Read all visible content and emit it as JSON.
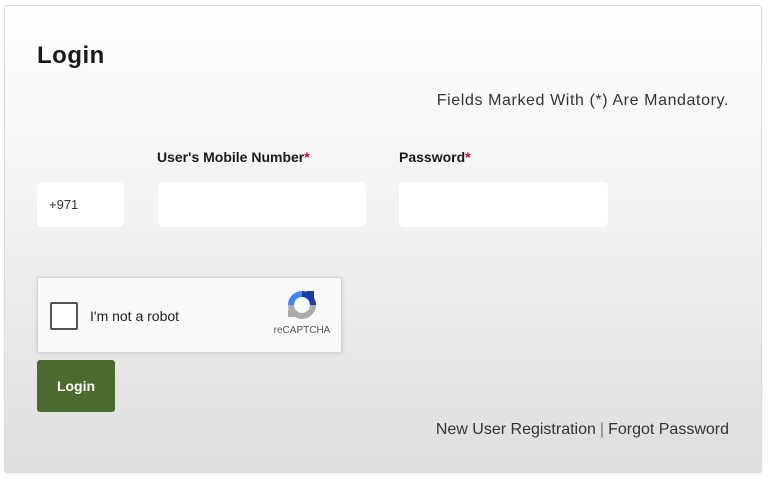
{
  "form": {
    "title": "Login",
    "mandatory_note": "Fields Marked With (*) Are Mandatory.",
    "mobile_label": "User's Mobile Number",
    "password_label": "Password",
    "required_mark": "*",
    "country_code": "+971",
    "mobile_value": "",
    "password_value": ""
  },
  "captcha": {
    "label": "I'm not a robot",
    "brand": "reCAPTCHA",
    "checked": false,
    "logo_icon": "recaptcha-logo-icon",
    "colors": {
      "blue": "#1c3aa9",
      "light_blue": "#4285f4",
      "grey": "#ababab"
    }
  },
  "actions": {
    "login_label": "Login",
    "register_label": "New User Registration",
    "separator": "|",
    "forgot_label": "Forgot Password"
  },
  "colors": {
    "accent": "#4a6a2e",
    "required": "#d0021b"
  }
}
